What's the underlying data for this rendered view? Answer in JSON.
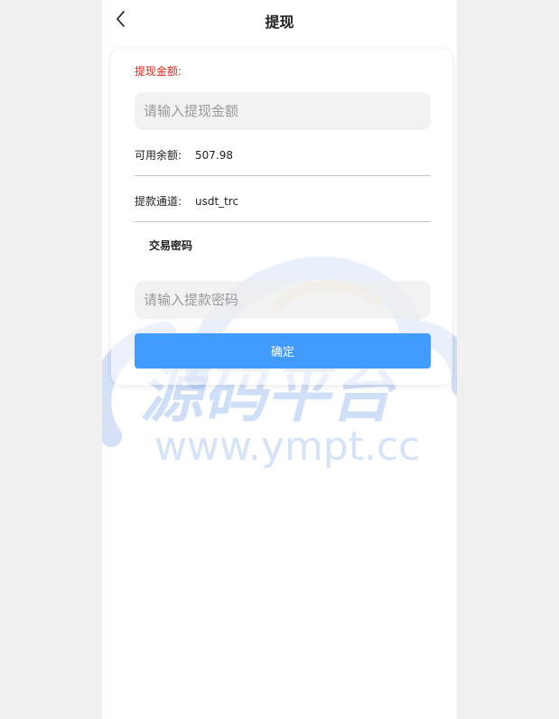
{
  "header": {
    "title": "提现"
  },
  "form": {
    "amount_label": "提现金额:",
    "amount_placeholder": "请输入提现金额",
    "balance_label": "可用余额:",
    "balance_value": "507.98",
    "channel_label": "提款通道:",
    "channel_value": "usdt_trc",
    "password_label": "交易密码",
    "password_placeholder": "请输入提款密码",
    "confirm_label": "确定"
  },
  "watermark": {
    "brand_text": "源码平台",
    "url_text": "www.ympt.cc"
  },
  "colors": {
    "accent": "#3a98ff",
    "label_red": "#e2231a",
    "input_bg": "#eeeeee",
    "page_bg": "#f0f0f0"
  }
}
